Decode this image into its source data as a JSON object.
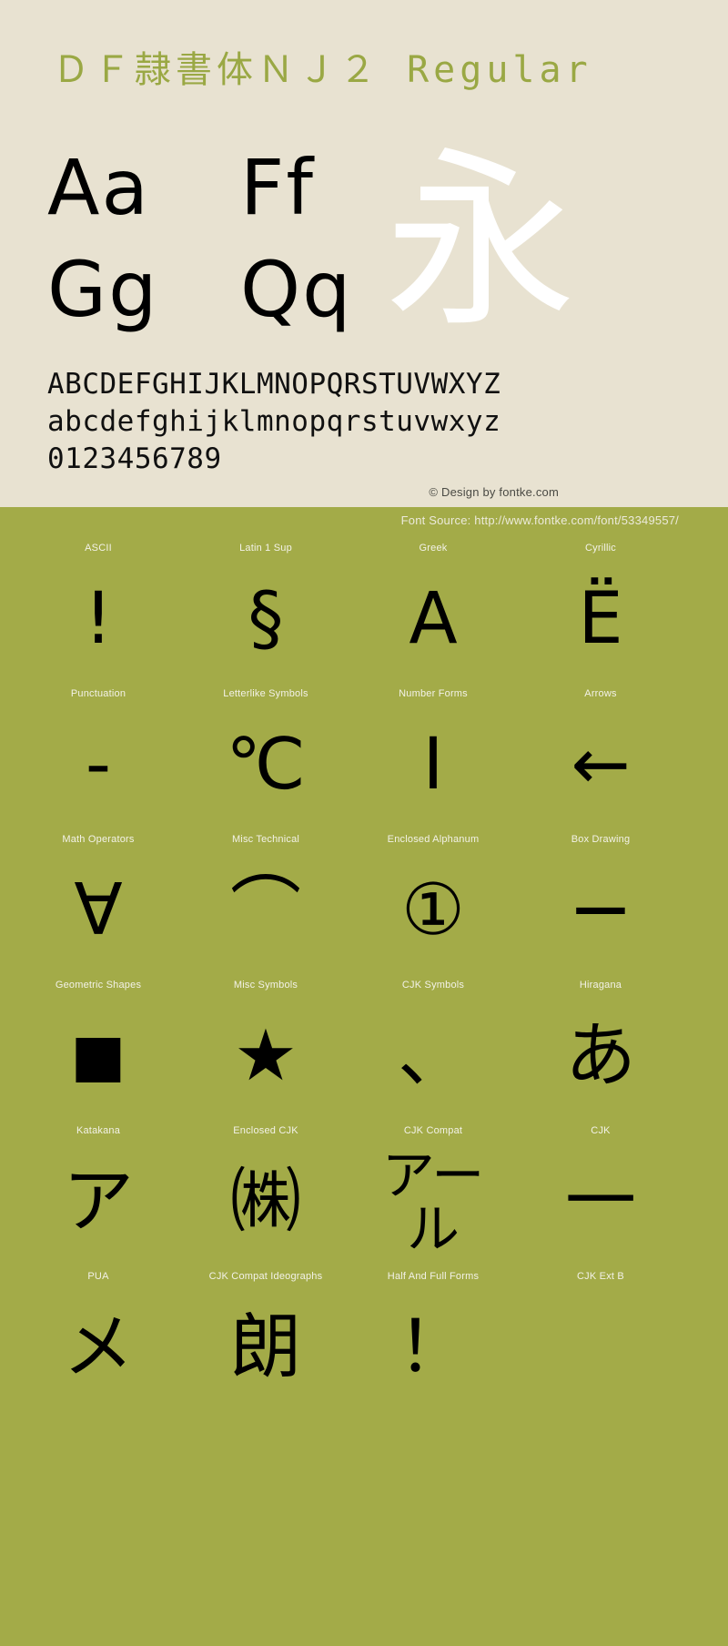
{
  "page": {
    "background_cream": "#e8e2d1",
    "background_green": "#a3ab48",
    "title_color": "#9aa844"
  },
  "header": {
    "font_title": "ＤＦ隷書体ＮＪ２ Regular"
  },
  "specimen": {
    "big_pairs": [
      [
        "Aa",
        "Ff"
      ],
      [
        "Gg",
        "Qq"
      ]
    ],
    "watermark_glyph": "永",
    "uppercase": "ABCDEFGHIJKLMNOPQRSTUVWXYZ",
    "lowercase": "abcdefghijklmnopqrstuvwxyz",
    "digits": "0123456789",
    "copyright": "© Design by fontke.com",
    "source": "Font Source: http://www.fontke.com/font/53349557/"
  },
  "unicode_blocks": [
    [
      {
        "label": "ASCII",
        "glyph": "!",
        "style": ""
      },
      {
        "label": "Latin 1 Sup",
        "glyph": "§",
        "style": ""
      },
      {
        "label": "Greek",
        "glyph": "Α",
        "style": ""
      },
      {
        "label": "Cyrillic",
        "glyph": "Ё",
        "style": ""
      }
    ],
    [
      {
        "label": "Punctuation",
        "glyph": "‐",
        "style": ""
      },
      {
        "label": "Letterlike Symbols",
        "glyph": "℃",
        "style": ""
      },
      {
        "label": "Number Forms",
        "glyph": "Ⅰ",
        "style": ""
      },
      {
        "label": "Arrows",
        "glyph": "←",
        "style": ""
      }
    ],
    [
      {
        "label": "Math Operators",
        "glyph": "∀",
        "style": ""
      },
      {
        "label": "Misc Technical",
        "glyph": "⌒",
        "style": ""
      },
      {
        "label": "Enclosed Alphanum",
        "glyph": "①",
        "style": ""
      },
      {
        "label": "Box Drawing",
        "glyph": "─",
        "style": "wide"
      }
    ],
    [
      {
        "label": "Geometric Shapes",
        "glyph": "■",
        "style": "small"
      },
      {
        "label": "Misc Symbols",
        "glyph": "★",
        "style": ""
      },
      {
        "label": "CJK Symbols",
        "glyph": "、",
        "style": ""
      },
      {
        "label": "Hiragana",
        "glyph": "あ",
        "style": ""
      }
    ],
    [
      {
        "label": "Katakana",
        "glyph": "ア",
        "style": ""
      },
      {
        "label": "Enclosed CJK",
        "glyph": "㈱",
        "style": ""
      },
      {
        "label": "CJK Compat",
        "glyph": "アール",
        "style": "two-line"
      },
      {
        "label": "CJK",
        "glyph": "一",
        "style": ""
      }
    ],
    [
      {
        "label": "PUA",
        "glyph": "メ",
        "style": ""
      },
      {
        "label": "CJK Compat Ideographs",
        "glyph": "朗",
        "style": ""
      },
      {
        "label": "Half And Full Forms",
        "glyph": "！",
        "style": ""
      },
      {
        "label": "CJK Ext B",
        "glyph": "",
        "style": ""
      }
    ]
  ]
}
